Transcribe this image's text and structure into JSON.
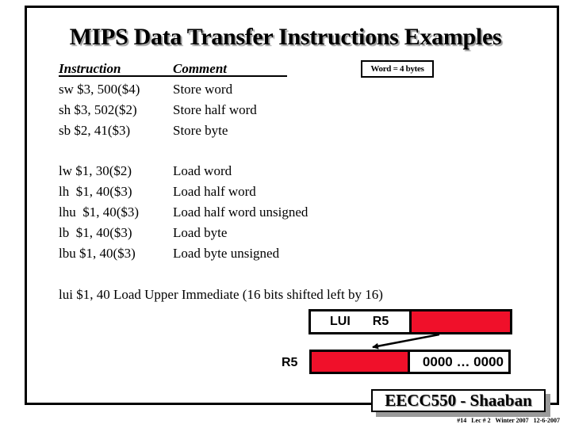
{
  "slide": {
    "title": "MIPS Data Transfer Instructions Examples",
    "table": {
      "headers": {
        "instruction": "Instruction",
        "comment": "Comment"
      },
      "store_rows": [
        {
          "instruction": "sw $3, 500($4)",
          "comment": "Store word"
        },
        {
          "instruction": "sh $3, 502($2)",
          "comment": "Store half word"
        },
        {
          "instruction": "sb $2, 41($3)",
          "comment": "Store byte"
        }
      ],
      "load_rows": [
        {
          "instruction": "lw $1, 30($2)",
          "comment": "Load word"
        },
        {
          "instruction": "lh  $1, 40($3)",
          "comment": "Load half word"
        },
        {
          "instruction": "lhu  $1, 40($3)",
          "comment": "Load half word unsigned"
        },
        {
          "instruction": "lb  $1, 40($3)",
          "comment": "Load byte"
        },
        {
          "instruction": "lbu $1, 40($3)",
          "comment": "Load byte unsigned"
        }
      ]
    },
    "note_box": "Word = 4 bytes",
    "lui_line": "lui $1, 40 Load Upper Immediate (16 bits shifted left by 16)",
    "diagram": {
      "upper_box": {
        "opcode_label": "LUI",
        "register_label": "R5"
      },
      "lower_box": {
        "side_label": "R5",
        "low_bits_label": "0000 … 0000"
      },
      "fill_color": "#f0102a"
    },
    "footer": {
      "course": "EECC550 - Shaaban",
      "meta": "#14   Lec # 2   Winter 2007   12-6-2007"
    }
  }
}
